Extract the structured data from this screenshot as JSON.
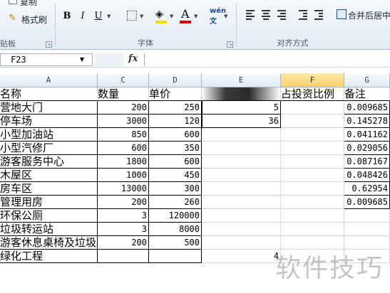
{
  "ribbon": {
    "clipboard": {
      "copy_label": "复制",
      "format_painter_label": "格式刷",
      "group_label": "贴板"
    },
    "font": {
      "bold": "B",
      "italic": "I",
      "underline": "U",
      "group_label": "字体"
    },
    "alignment": {
      "merge_label": "合并后居中",
      "group_label": "对齐方式"
    },
    "colors": {
      "fill_accent": "#ffd800",
      "font_accent": "#e00000"
    }
  },
  "formula_bar": {
    "name_box": "F23",
    "fx_label": "fx",
    "formula": ""
  },
  "grid": {
    "columns": [
      "A",
      "C",
      "D",
      "E",
      "F",
      "G"
    ],
    "selected_column": "F",
    "header_row": [
      "名称",
      "数量",
      "单价",
      "",
      "占投资比例",
      "备注"
    ],
    "rows": [
      {
        "name": "营地大门",
        "qty": "200",
        "price": "250",
        "e": "5",
        "g": "0.009685"
      },
      {
        "name": "停车场",
        "qty": "3000",
        "price": "120",
        "e": "36",
        "g": "0.145278"
      },
      {
        "name": "小型加油站",
        "qty": "850",
        "price": "600",
        "e": "",
        "g": "0.041162"
      },
      {
        "name": "小型汽修厂",
        "qty": "600",
        "price": "350",
        "e": "",
        "g": "0.029056"
      },
      {
        "name": "游客服务中心",
        "qty": "1800",
        "price": "600",
        "e": "",
        "g": "0.087167"
      },
      {
        "name": "木屋区",
        "qty": "1000",
        "price": "450",
        "e": "",
        "g": "0.048426"
      },
      {
        "name": "房车区",
        "qty": "13000",
        "price": "300",
        "e": "",
        "g": "0.62954"
      },
      {
        "name": "管理用房",
        "qty": "200",
        "price": "260",
        "e": "",
        "g": "0.009685"
      },
      {
        "name": "环保公厕",
        "qty": "3",
        "price": "120000",
        "e": "",
        "g": ""
      },
      {
        "name": "垃圾转运站",
        "qty": "3",
        "price": "8000",
        "e": "",
        "g": ""
      },
      {
        "name": "游客休息桌椅及垃圾",
        "qty": "200",
        "price": "500",
        "e": "",
        "g": ""
      },
      {
        "name": "绿化工程",
        "qty": "",
        "price": "",
        "e": "4",
        "g": ""
      }
    ]
  },
  "watermark": "软件技巧"
}
